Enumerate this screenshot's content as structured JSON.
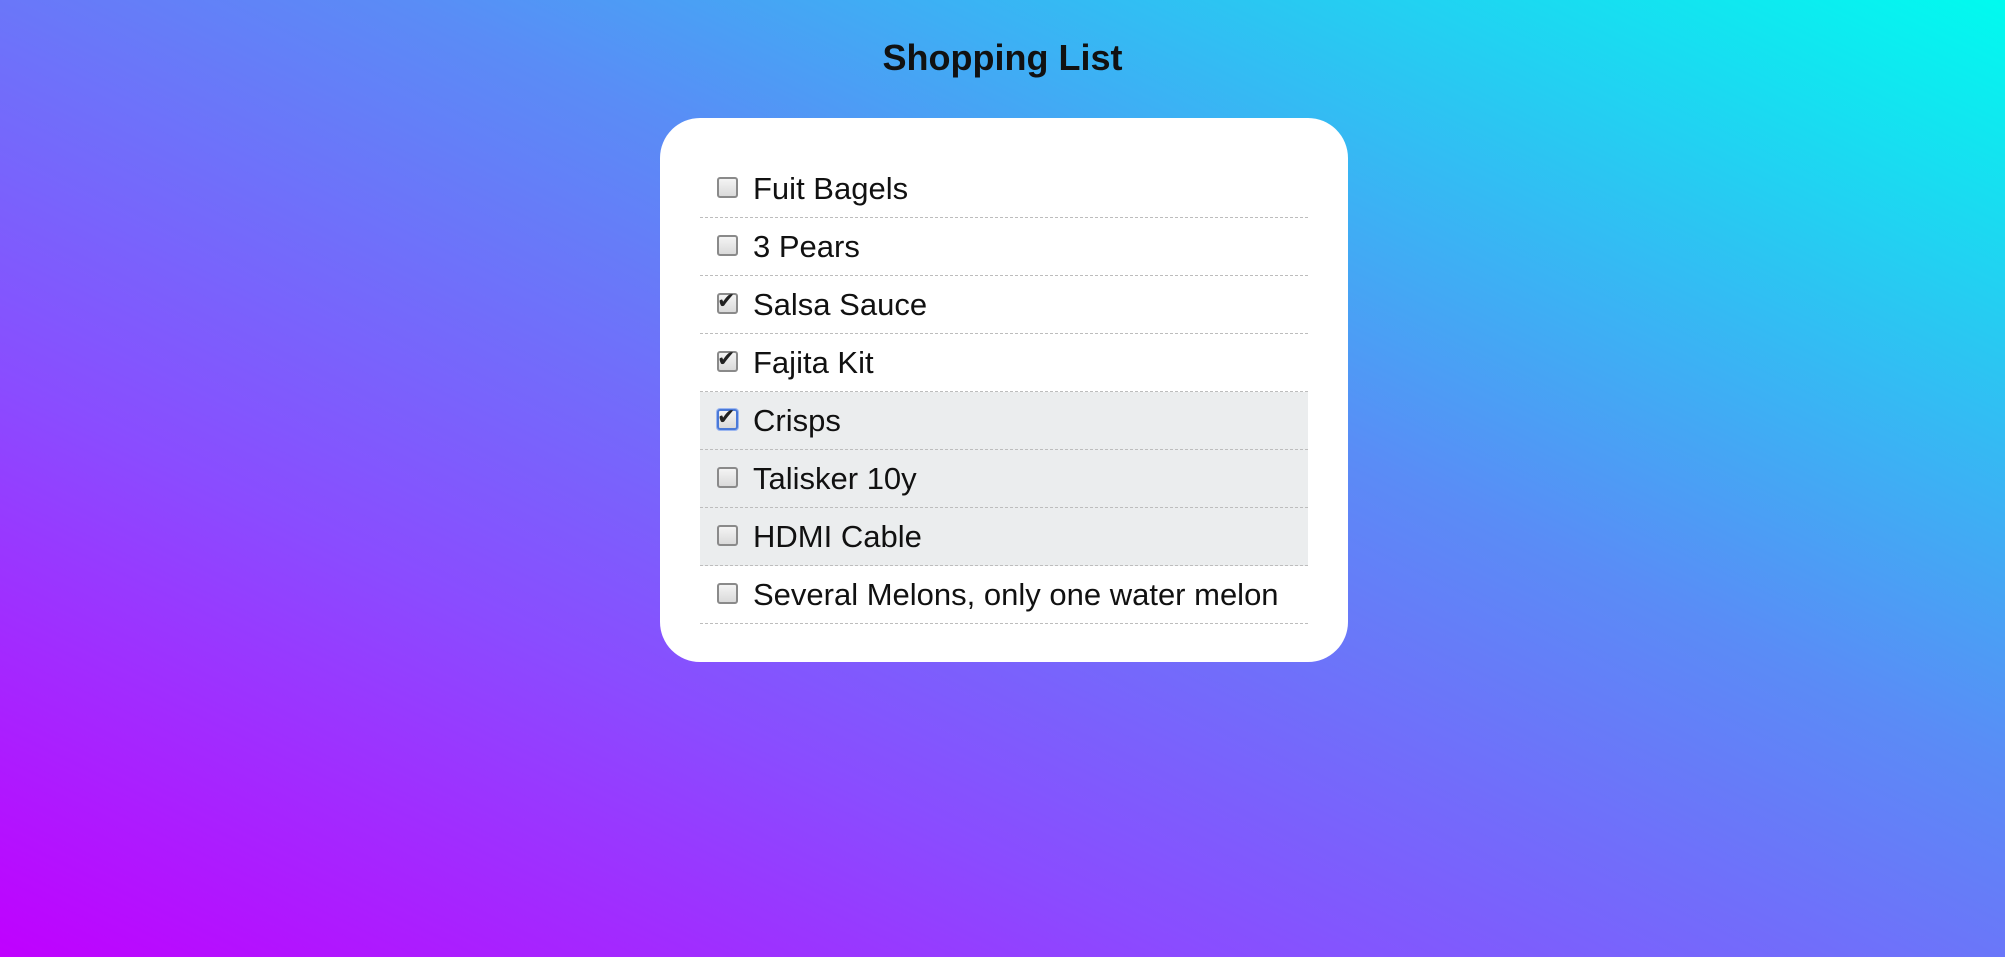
{
  "page": {
    "title": "Shopping List"
  },
  "list": {
    "items": [
      {
        "label": "Fuit Bagels",
        "checked": false
      },
      {
        "label": "3 Pears",
        "checked": false
      },
      {
        "label": "Salsa Sauce",
        "checked": true
      },
      {
        "label": "Fajita Kit",
        "checked": true
      },
      {
        "label": "Crisps",
        "checked": true
      },
      {
        "label": "Talisker 10y",
        "checked": false
      },
      {
        "label": "HDMI Cable",
        "checked": false
      },
      {
        "label": "Several Melons, only one water melon",
        "checked": false
      }
    ]
  },
  "colors": {
    "gradient_bottom_left": "#c000ff",
    "gradient_top_right": "#00fbef",
    "card": "#ffffff",
    "highlight_row": "#ebedee"
  }
}
